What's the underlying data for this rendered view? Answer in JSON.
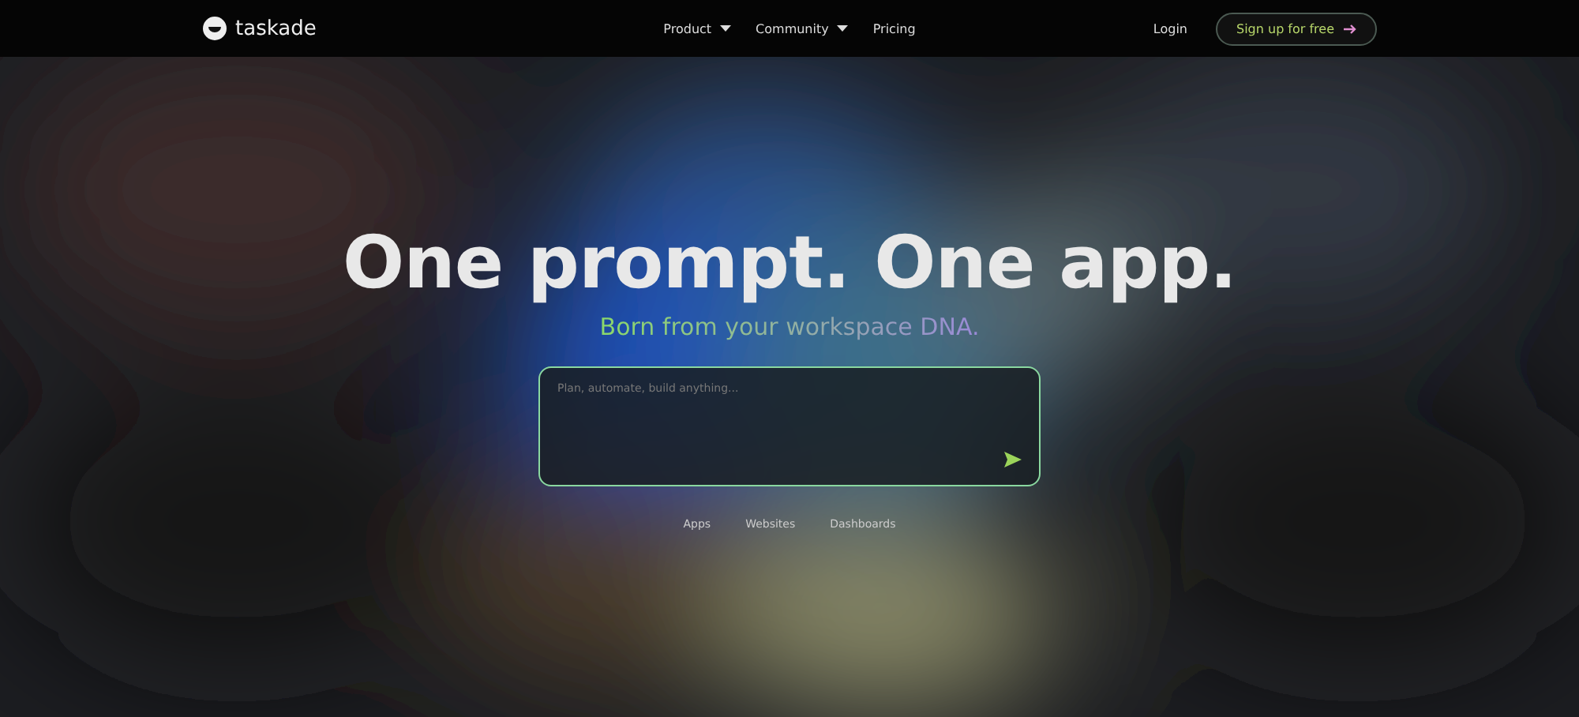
{
  "nav": {
    "logo": "taskade",
    "menu": [
      {
        "label": "Product",
        "dropdown": true
      },
      {
        "label": "Community",
        "dropdown": true
      },
      {
        "label": "Pricing",
        "dropdown": false
      }
    ],
    "login": "Login",
    "signup": "Sign up for free"
  },
  "hero": {
    "title": "One prompt. One app.",
    "subtitle": "Born from your workspace DNA.",
    "prompt": {
      "placeholder": "Plan, automate, build anything..."
    },
    "chips": [
      "Apps",
      "Websites",
      "Dashboards"
    ]
  }
}
